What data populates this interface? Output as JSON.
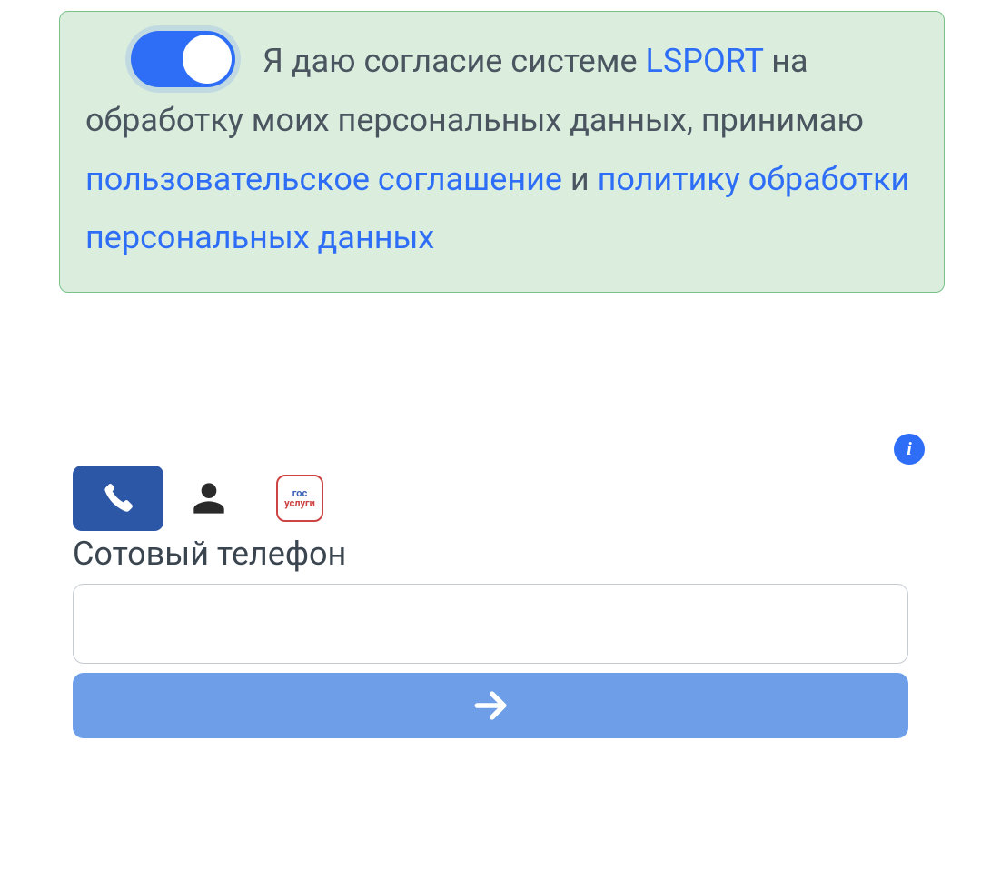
{
  "consent": {
    "text_prefix": "Я даю согласие системе ",
    "link_lsport": "LSPORT",
    "text_mid1": " на обработку моих персональных данных, принимаю ",
    "link_agreement": "пользовательское соглашение",
    "text_mid2": " и ",
    "link_policy": "политику обработки персональных данных",
    "toggle_on": true
  },
  "login": {
    "field_label": "Сотовый телефон",
    "phone_value": "",
    "gosuslugi_line1": "гос",
    "gosuslugi_line2": "услуги"
  },
  "colors": {
    "primary_blue": "#2e6ef7",
    "dark_blue": "#2c57a6",
    "light_blue": "#6e9ee8",
    "green_bg": "#dbeede",
    "green_border": "#7ac18a",
    "text_gray": "#4a5560"
  }
}
